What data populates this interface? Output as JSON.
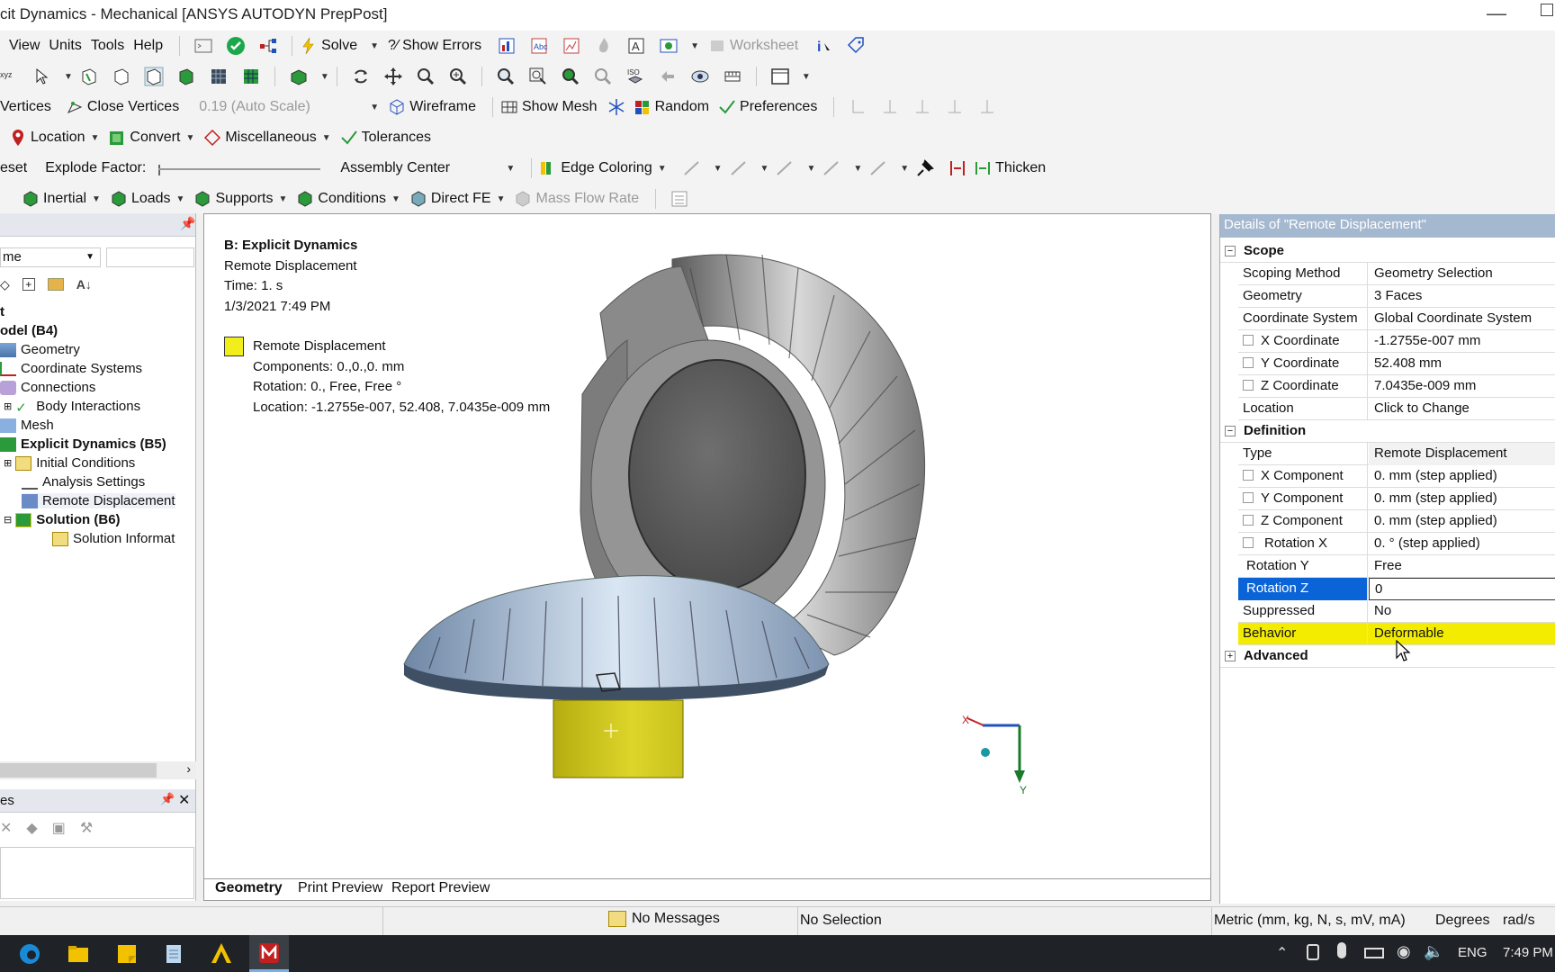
{
  "window": {
    "title": "cit Dynamics - Mechanical [ANSYS AUTODYN PrepPost]"
  },
  "menu": {
    "items": [
      "View",
      "Units",
      "Tools",
      "Help"
    ],
    "solve": "Solve",
    "show_errors": "?⁄ Show Errors",
    "worksheet": "Worksheet"
  },
  "toolbar3": {
    "vertices": "Vertices",
    "close_vertices": "Close Vertices",
    "scale": "0.19 (Auto Scale)",
    "wireframe": "Wireframe",
    "show_mesh": "Show Mesh",
    "random": "Random",
    "preferences": "Preferences"
  },
  "toolbar4": {
    "location": "Location",
    "convert": "Convert",
    "miscellaneous": "Miscellaneous",
    "tolerances": "Tolerances"
  },
  "toolbar5": {
    "reset": "eset",
    "explode_factor": "Explode Factor:",
    "assembly_center": "Assembly Center",
    "edge_coloring": "Edge Coloring",
    "thicken": "Thicken"
  },
  "toolbar6": {
    "inertial": "Inertial",
    "loads": "Loads",
    "supports": "Supports",
    "conditions": "Conditions",
    "direct_fe": "Direct FE",
    "mass_flow_rate": "Mass Flow Rate"
  },
  "tree": {
    "filter_value": "me",
    "items": [
      {
        "label": "t",
        "bold": true
      },
      {
        "label": "odel (B4)",
        "bold": true
      },
      {
        "label": "Geometry",
        "bold": false
      },
      {
        "label": "Coordinate Systems",
        "bold": false
      },
      {
        "label": "Connections",
        "bold": false
      },
      {
        "label": "Body Interactions",
        "bold": false
      },
      {
        "label": "Mesh",
        "bold": false
      },
      {
        "label": "Explicit Dynamics (B5)",
        "bold": true
      },
      {
        "label": "Initial Conditions",
        "bold": false
      },
      {
        "label": "Analysis Settings",
        "bold": false
      },
      {
        "label": "Remote Displacement",
        "bold": false
      },
      {
        "label": "Solution (B6)",
        "bold": true
      },
      {
        "label": "Solution Informat",
        "bold": false
      }
    ]
  },
  "bottom_panel": {
    "title": "es"
  },
  "viewport": {
    "analysis": "B: Explicit Dynamics",
    "object": "Remote Displacement",
    "time": "Time: 1. s",
    "date": "1/3/2021 7:49 PM",
    "legend_name": "Remote Displacement",
    "components": "Components: 0.,0.,0. mm",
    "rotation": "Rotation: 0., Free, Free °",
    "location": "Location: -1.2755e-007, 52.408, 7.0435e-009 mm",
    "triad_x": "X",
    "triad_y": "Y",
    "legend_color": "#f2ee1c"
  },
  "view_tabs": [
    "Geometry",
    "Print Preview",
    "Report Preview"
  ],
  "details": {
    "title": "Details of \"Remote Displacement\"",
    "scope_label": "Scope",
    "definition_label": "Definition",
    "advanced_label": "Advanced",
    "scope_rows": [
      {
        "k": "Scoping Method",
        "v": "Geometry Selection"
      },
      {
        "k": "Geometry",
        "v": "3 Faces"
      },
      {
        "k": "Coordinate System",
        "v": "Global Coordinate System"
      },
      {
        "k": "X Coordinate",
        "v": "-1.2755e-007 mm"
      },
      {
        "k": "Y Coordinate",
        "v": "52.408 mm"
      },
      {
        "k": "Z Coordinate",
        "v": "7.0435e-009 mm"
      },
      {
        "k": "Location",
        "v": "Click to Change"
      }
    ],
    "definition_rows": [
      {
        "k": "Type",
        "v": "Remote Displacement"
      },
      {
        "k": "X Component",
        "v": "0. mm  (step applied)"
      },
      {
        "k": "Y Component",
        "v": "0. mm  (step applied)"
      },
      {
        "k": "Z Component",
        "v": "0. mm  (step applied)"
      },
      {
        "k": "Rotation X",
        "v": "0. °  (step applied)"
      },
      {
        "k": "Rotation Y",
        "v": "Free"
      },
      {
        "k": "Rotation Z",
        "v": "0"
      },
      {
        "k": "Suppressed",
        "v": "No"
      },
      {
        "k": "Behavior",
        "v": "Deformable"
      }
    ]
  },
  "status": {
    "messages": "No Messages",
    "selection": "No Selection",
    "units": "Metric (mm, kg, N, s, mV, mA)",
    "degrees": "Degrees",
    "rads": "rad/s"
  },
  "taskbar": {
    "lang": "ENG",
    "time": "7:49 PM"
  }
}
